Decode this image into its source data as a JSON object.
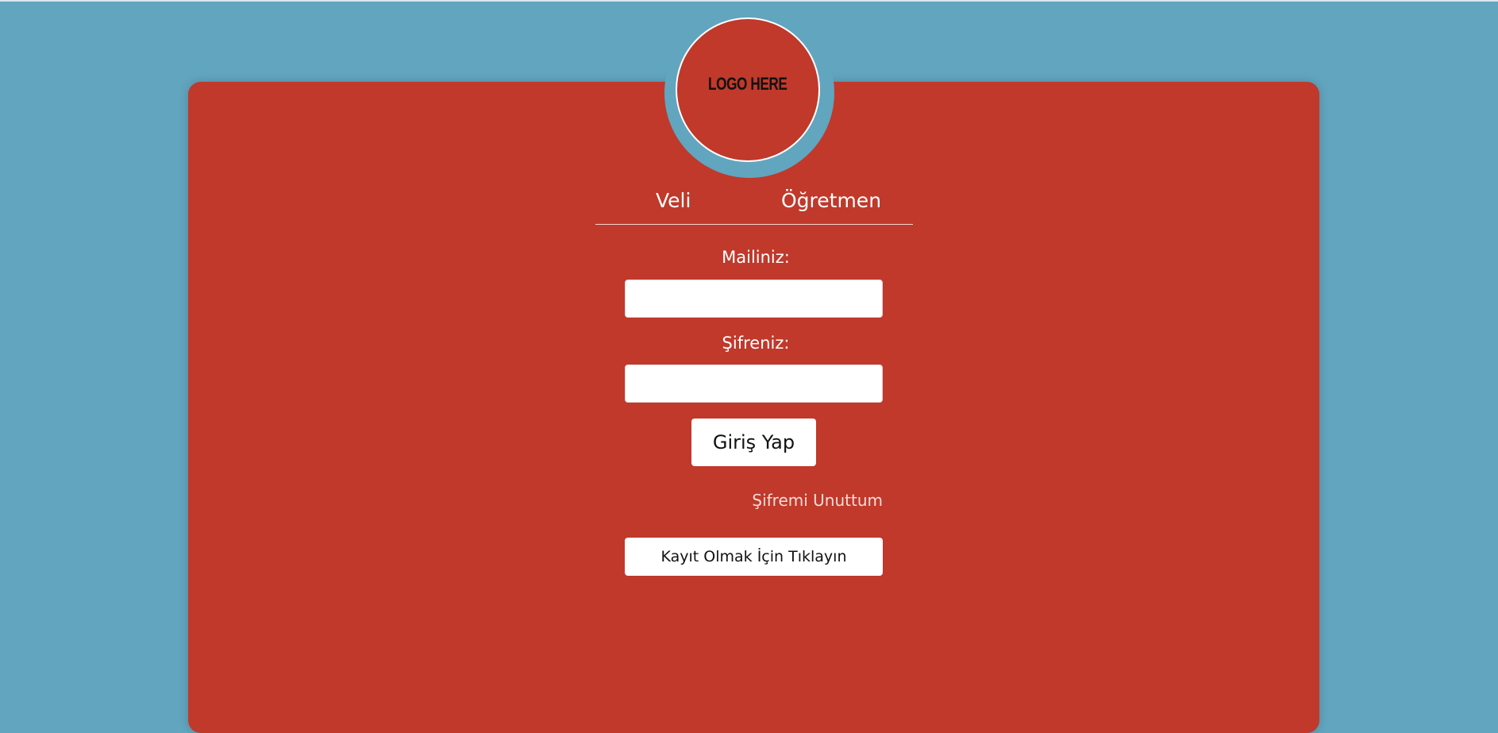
{
  "logo": {
    "text": "LOGO HERE"
  },
  "tabs": [
    {
      "label": "Veli"
    },
    {
      "label": "Öğretmen"
    }
  ],
  "form": {
    "email_label": "Mailiniz:",
    "email_value": "",
    "password_label": "Şifreniz:",
    "password_value": "",
    "login_button": "Giriş Yap",
    "forgot_link": "Şifremi Unuttum",
    "register_button": "Kayıt Olmak İçin Tıklayın"
  },
  "colors": {
    "background": "#62a5bf",
    "card": "#c0392b",
    "text": "#ffffff"
  }
}
